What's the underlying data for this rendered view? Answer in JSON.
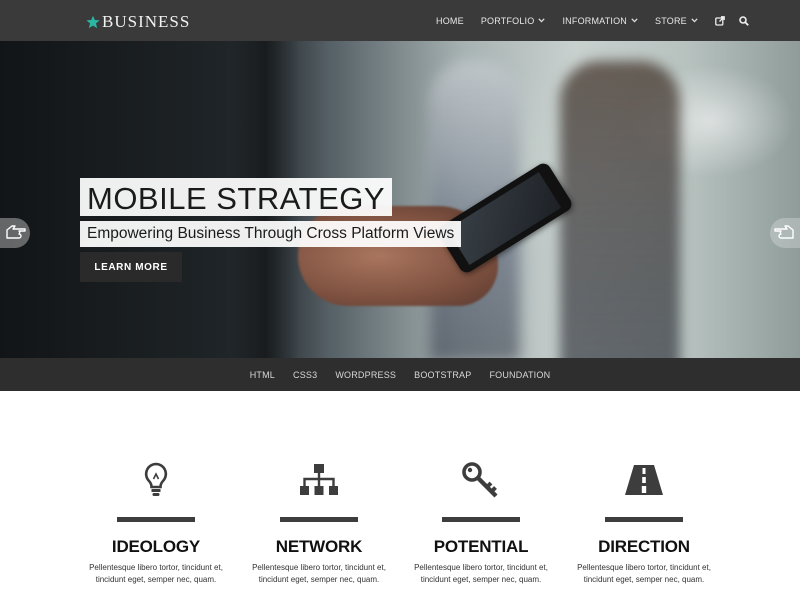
{
  "brand": {
    "name": "BUSINESS",
    "star_color": "#2bb6a3",
    "icon": "star-icon"
  },
  "nav": {
    "items": [
      {
        "label": "HOME",
        "has_dropdown": false
      },
      {
        "label": "PORTFOLIO",
        "has_dropdown": true
      },
      {
        "label": "INFORMATION",
        "has_dropdown": true
      },
      {
        "label": "STORE",
        "has_dropdown": true
      }
    ],
    "icons": [
      "external-link-icon",
      "search-icon"
    ]
  },
  "hero": {
    "title": "MOBILE STRATEGY",
    "subtitle": "Empowering Business Through Cross Platform Views",
    "button_label": "LEARN MORE",
    "prev_icon": "hand-pointing-left-icon",
    "next_icon": "hand-pointing-right-icon"
  },
  "tags": [
    "HTML",
    "CSS3",
    "WORDPRESS",
    "BOOTSTRAP",
    "FOUNDATION"
  ],
  "features": [
    {
      "icon": "lightbulb-icon",
      "title": "IDEOLOGY",
      "line1": "Pellentesque libero tortor, tincidunt et,",
      "line2": "tincidunt eget, semper nec, quam."
    },
    {
      "icon": "sitemap-icon",
      "title": "NETWORK",
      "line1": "Pellentesque libero tortor, tincidunt et,",
      "line2": "tincidunt eget, semper nec, quam."
    },
    {
      "icon": "key-icon",
      "title": "POTENTIAL",
      "line1": "Pellentesque libero tortor, tincidunt et,",
      "line2": "tincidunt eget, semper nec, quam."
    },
    {
      "icon": "road-icon",
      "title": "DIRECTION",
      "line1": "Pellentesque libero tortor, tincidunt et,",
      "line2": "tincidunt eget, semper nec, quam."
    }
  ],
  "colors": {
    "nav_bg": "#3a3a3a",
    "tagbar_bg": "#2e2e2e",
    "accent": "#2bb6a3",
    "icon_dark": "#3d3d3d"
  }
}
